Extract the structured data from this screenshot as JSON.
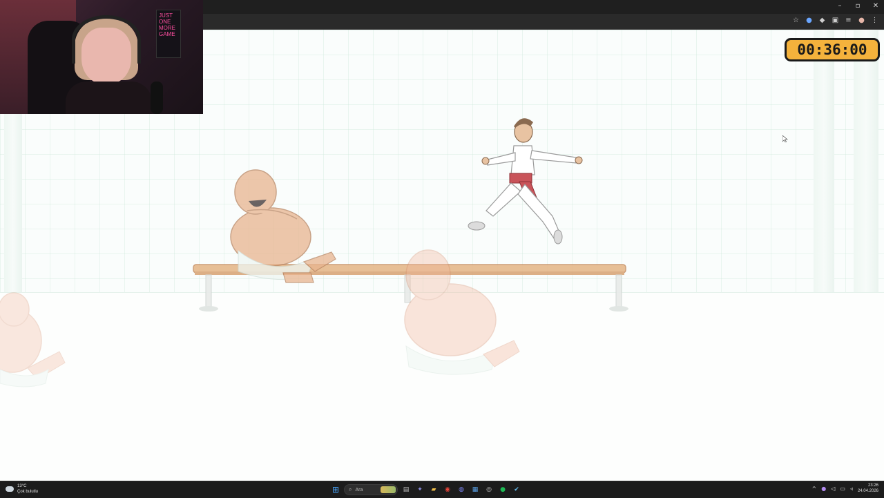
{
  "window": {
    "controls": {
      "minimize": "–",
      "maximize": "▫",
      "close": "✕"
    }
  },
  "browser_toolbar": {
    "icons": [
      "star-icon",
      "extension-icon",
      "diamond-icon",
      "puzzle-icon",
      "media-icon",
      "profile-icon",
      "menu-icon"
    ]
  },
  "webcam": {
    "poster_text": "JUST ONE MORE GAME"
  },
  "game": {
    "timer": "00:36:00"
  },
  "taskbar": {
    "weather": {
      "temperature": "13°C",
      "condition": "Çok bulutlu"
    },
    "search_placeholder": "Ara",
    "pinned_apps": [
      {
        "name": "start-button",
        "color": "#3aa0ff"
      },
      {
        "name": "task-view-icon",
        "color": "#6b6b6b"
      },
      {
        "name": "teams-icon",
        "color": "#6264a7"
      },
      {
        "name": "file-explorer-icon",
        "color": "#f2c04a"
      },
      {
        "name": "chrome-icon",
        "color": "#e9453a"
      },
      {
        "name": "discord-icon",
        "color": "#5865f2"
      },
      {
        "name": "calendar-icon",
        "color": "#2b6cb8"
      },
      {
        "name": "obs-icon",
        "color": "#3b3b3b"
      },
      {
        "name": "spotify-icon",
        "color": "#1db954"
      },
      {
        "name": "steam-icon",
        "color": "#1b2838"
      }
    ],
    "clock": {
      "time": "23:26",
      "date": "24.04.2026"
    }
  },
  "colors": {
    "timer_bg": "#f4b23c",
    "sash": "#c9545a",
    "bench": "#d9a77a",
    "faded_skin": "#f3c1a8"
  }
}
